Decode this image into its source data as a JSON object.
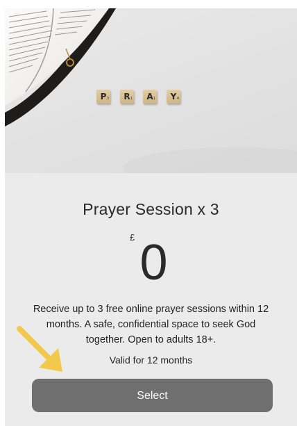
{
  "hero": {
    "tiles": [
      "P",
      "R",
      "A",
      "Y"
    ],
    "tile_subscripts": [
      "3",
      "1",
      "1",
      "4"
    ]
  },
  "product": {
    "title": "Prayer Session x 3",
    "currency_symbol": "£",
    "price": "0",
    "description": "Receive up to 3 free online prayer sessions within 12 months. A safe, confidential space to seek God together. Open to adults 18+.",
    "validity": "Valid for 12 months"
  },
  "actions": {
    "select_label": "Select"
  },
  "colors": {
    "button_bg": "#6f6f6f",
    "card_bg": "#ebebeb",
    "arrow": "#f2c94c"
  }
}
